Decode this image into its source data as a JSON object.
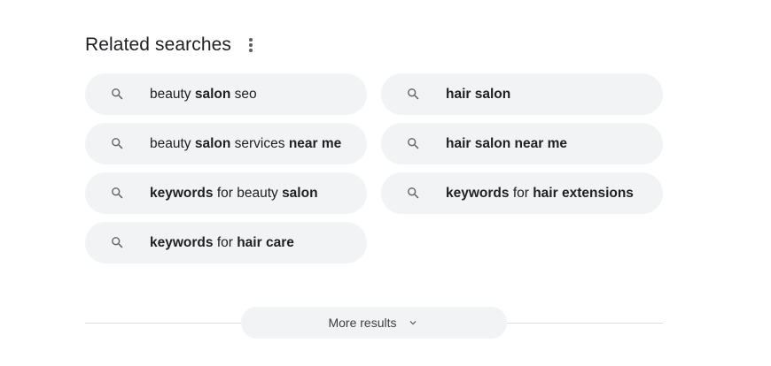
{
  "header": {
    "title": "Related searches",
    "menu_icon": "more-vert-icon"
  },
  "related": [
    {
      "icon": "search-icon",
      "segments": [
        {
          "text": "beauty ",
          "bold": false
        },
        {
          "text": "salon",
          "bold": true
        },
        {
          "text": " seo",
          "bold": false
        }
      ]
    },
    {
      "icon": "search-icon",
      "segments": [
        {
          "text": "hair salon",
          "bold": true
        }
      ]
    },
    {
      "icon": "search-icon",
      "segments": [
        {
          "text": "beauty ",
          "bold": false
        },
        {
          "text": "salon",
          "bold": true
        },
        {
          "text": " services ",
          "bold": false
        },
        {
          "text": "near me",
          "bold": true
        }
      ]
    },
    {
      "icon": "search-icon",
      "segments": [
        {
          "text": "hair salon near me",
          "bold": true
        }
      ]
    },
    {
      "icon": "search-icon",
      "segments": [
        {
          "text": "keywords",
          "bold": true
        },
        {
          "text": " for beauty ",
          "bold": false
        },
        {
          "text": "salon",
          "bold": true
        }
      ]
    },
    {
      "icon": "search-icon",
      "segments": [
        {
          "text": "keywords",
          "bold": true
        },
        {
          "text": " for ",
          "bold": false
        },
        {
          "text": "hair extensions",
          "bold": true
        }
      ]
    },
    {
      "icon": "search-icon",
      "segments": [
        {
          "text": "keywords",
          "bold": true
        },
        {
          "text": " for ",
          "bold": false
        },
        {
          "text": "hair care",
          "bold": true
        }
      ]
    }
  ],
  "more_results": {
    "label": "More results",
    "icon": "chevron-down-icon"
  },
  "colors": {
    "chip_bg": "#f1f3f4",
    "text": "#202124",
    "icon": "#5f6368",
    "divider": "#dadce0"
  }
}
